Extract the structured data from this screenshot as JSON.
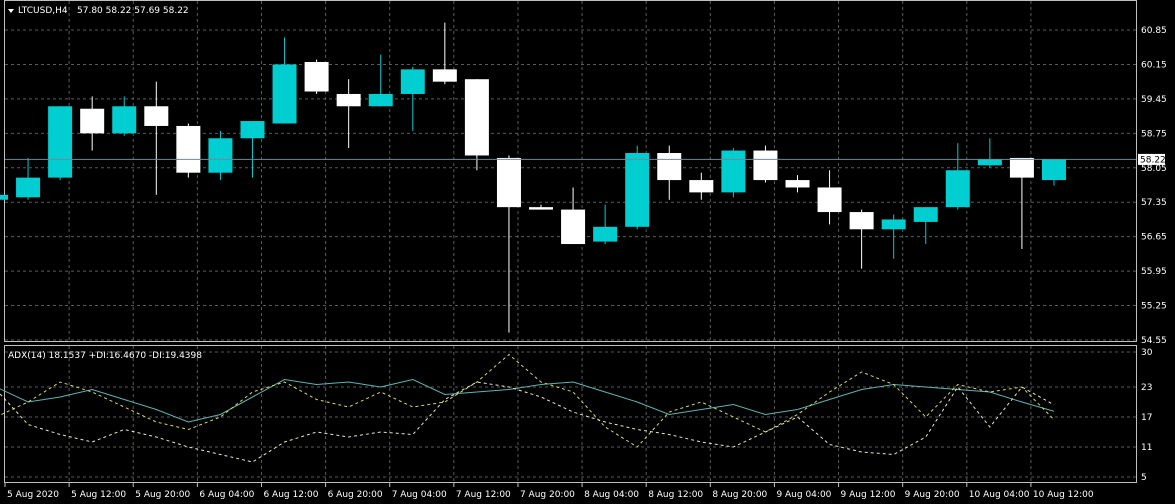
{
  "header": {
    "symbol": "LTCUSD,H4",
    "ohlc": "57.80 58.22 57.69 58.22"
  },
  "indicator": {
    "label": "ADX(14) 18.1537 +DI:16.4670 -DI:19.4398"
  },
  "colors": {
    "background": "#000000",
    "grid": "#5a5a5a",
    "frame": "#bfbfbf",
    "bull": "#00ced1",
    "bear": "#ffffff",
    "bid_line": "#6d8c9a",
    "adx": "#5fb3b3",
    "plus_di": "#d8d860",
    "minus_di": "#e8e8c8"
  },
  "chart_data": [
    {
      "type": "candlestick",
      "timeframe": "H4",
      "price_axis": {
        "ticks": [
          "60.85",
          "60.15",
          "59.45",
          "58.75",
          "58.05",
          "57.35",
          "56.65",
          "55.95",
          "55.25",
          "54.55"
        ],
        "range": [
          54.55,
          61.2
        ]
      },
      "time_axis": {
        "labels": [
          "5 Aug 2020",
          "5 Aug 12:00",
          "5 Aug 20:00",
          "6 Aug 04:00",
          "6 Aug 12:00",
          "6 Aug 20:00",
          "7 Aug 04:00",
          "7 Aug 12:00",
          "7 Aug 20:00",
          "8 Aug 04:00",
          "8 Aug 12:00",
          "8 Aug 20:00",
          "9 Aug 04:00",
          "9 Aug 12:00",
          "9 Aug 20:00",
          "10 Aug 04:00",
          "10 Aug 12:00"
        ]
      },
      "current_price": "58.22",
      "candles": [
        {
          "o": 57.4,
          "h": 57.5,
          "l": 56.7,
          "c": 57.5
        },
        {
          "o": 57.45,
          "h": 58.25,
          "l": 57.4,
          "c": 57.85
        },
        {
          "o": 57.85,
          "h": 59.3,
          "l": 57.8,
          "c": 59.3
        },
        {
          "o": 59.25,
          "h": 59.5,
          "l": 58.4,
          "c": 58.75
        },
        {
          "o": 58.75,
          "h": 59.5,
          "l": 58.7,
          "c": 59.3
        },
        {
          "o": 59.3,
          "h": 59.8,
          "l": 57.5,
          "c": 58.9
        },
        {
          "o": 58.9,
          "h": 58.95,
          "l": 57.85,
          "c": 57.95
        },
        {
          "o": 57.95,
          "h": 58.8,
          "l": 57.8,
          "c": 58.65
        },
        {
          "o": 58.65,
          "h": 59.0,
          "l": 57.85,
          "c": 59.0
        },
        {
          "o": 58.95,
          "h": 60.7,
          "l": 58.95,
          "c": 60.15
        },
        {
          "o": 60.2,
          "h": 60.25,
          "l": 59.55,
          "c": 59.6
        },
        {
          "o": 59.55,
          "h": 59.85,
          "l": 58.45,
          "c": 59.3
        },
        {
          "o": 59.3,
          "h": 60.35,
          "l": 59.3,
          "c": 59.55
        },
        {
          "o": 59.55,
          "h": 60.1,
          "l": 58.8,
          "c": 60.05
        },
        {
          "o": 60.05,
          "h": 61.0,
          "l": 59.75,
          "c": 59.8
        },
        {
          "o": 59.85,
          "h": 59.85,
          "l": 58.0,
          "c": 58.3
        },
        {
          "o": 58.25,
          "h": 58.3,
          "l": 54.7,
          "c": 57.25
        },
        {
          "o": 57.25,
          "h": 57.3,
          "l": 57.2,
          "c": 57.2
        },
        {
          "o": 57.2,
          "h": 57.65,
          "l": 56.6,
          "c": 56.5
        },
        {
          "o": 56.55,
          "h": 57.3,
          "l": 56.5,
          "c": 56.85
        },
        {
          "o": 56.85,
          "h": 58.5,
          "l": 56.8,
          "c": 58.35
        },
        {
          "o": 58.35,
          "h": 58.5,
          "l": 57.4,
          "c": 57.8
        },
        {
          "o": 57.8,
          "h": 57.95,
          "l": 57.4,
          "c": 57.55
        },
        {
          "o": 57.55,
          "h": 58.45,
          "l": 57.45,
          "c": 58.4
        },
        {
          "o": 58.4,
          "h": 58.5,
          "l": 57.75,
          "c": 57.8
        },
        {
          "o": 57.8,
          "h": 57.9,
          "l": 57.55,
          "c": 57.65
        },
        {
          "o": 57.65,
          "h": 58.0,
          "l": 56.9,
          "c": 57.15
        },
        {
          "o": 57.15,
          "h": 57.2,
          "l": 56.0,
          "c": 56.8
        },
        {
          "o": 56.8,
          "h": 57.1,
          "l": 56.2,
          "c": 57.0
        },
        {
          "o": 56.95,
          "h": 57.25,
          "l": 56.5,
          "c": 57.25
        },
        {
          "o": 57.25,
          "h": 58.55,
          "l": 57.2,
          "c": 58.0
        },
        {
          "o": 58.1,
          "h": 58.65,
          "l": 58.05,
          "c": 58.22
        },
        {
          "o": 58.25,
          "h": 58.25,
          "l": 56.4,
          "c": 57.85
        },
        {
          "o": 57.8,
          "h": 58.22,
          "l": 57.69,
          "c": 58.22
        }
      ]
    },
    {
      "type": "line",
      "indicator": "ADX(14)",
      "y_axis": {
        "ticks": [
          "30",
          "23",
          "17",
          "11",
          "5"
        ],
        "range": [
          5,
          30
        ]
      },
      "series": [
        {
          "name": "ADX",
          "values": [
            23.0,
            20.0,
            21.0,
            22.5,
            20.5,
            18.5,
            16.0,
            17.5,
            21.0,
            24.5,
            23.5,
            24.0,
            23.0,
            24.5,
            21.5,
            22.0,
            22.5,
            23.5,
            24.0,
            22.0,
            20.0,
            17.5,
            18.5,
            19.5,
            17.5,
            18.5,
            20.5,
            22.5,
            23.5,
            23.0,
            22.5,
            22.0,
            20.0,
            18.15
          ]
        },
        {
          "name": "+DI",
          "values": [
            17.0,
            20.0,
            24.0,
            22.0,
            19.0,
            16.0,
            14.5,
            17.0,
            22.0,
            24.0,
            20.5,
            19.0,
            22.0,
            19.0,
            20.0,
            24.0,
            29.5,
            24.0,
            22.0,
            15.0,
            11.0,
            18.0,
            20.0,
            17.0,
            14.0,
            17.5,
            22.0,
            26.0,
            23.5,
            17.0,
            23.5,
            22.0,
            23.0,
            16.47
          ]
        },
        {
          "name": "-DI",
          "values": [
            22.5,
            15.5,
            13.5,
            12.0,
            14.5,
            13.0,
            11.0,
            9.5,
            8.0,
            12.0,
            14.0,
            13.0,
            14.0,
            13.5,
            20.5,
            24.0,
            23.0,
            21.0,
            18.0,
            16.0,
            14.5,
            13.5,
            12.0,
            11.0,
            14.0,
            17.0,
            11.5,
            10.0,
            9.5,
            13.0,
            23.0,
            15.0,
            23.0,
            19.44
          ]
        }
      ]
    }
  ]
}
